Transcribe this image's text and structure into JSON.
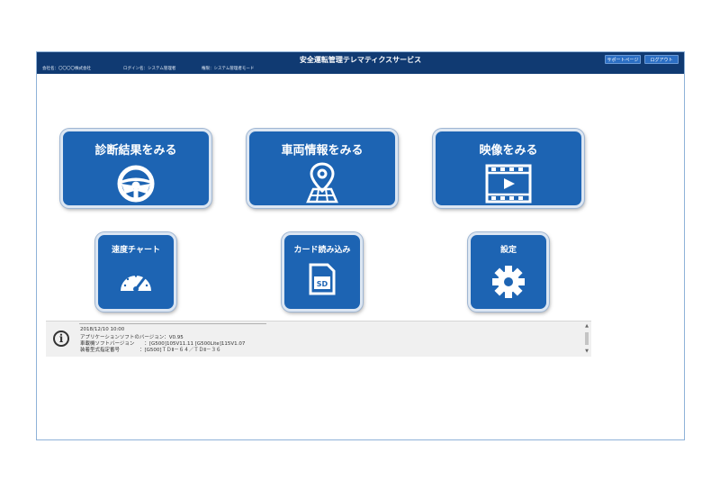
{
  "header": {
    "title": "安全運転管理テレマティクスサービス",
    "company": "会社名：〇〇〇〇株式会社",
    "login_name": "ログイン名：システム管理者",
    "permission": "権限：システム管理者モード",
    "support_button": "サポートページ",
    "logout_button": "ログアウト"
  },
  "tiles": {
    "diagnosis": {
      "label": "診断結果をみる",
      "icon": "steering-wheel-icon"
    },
    "vehicle": {
      "label": "車両情報をみる",
      "icon": "map-pin-icon"
    },
    "video": {
      "label": "映像をみる",
      "icon": "video-play-icon"
    },
    "speed_chart": {
      "label": "速度チャート",
      "icon": "speedometer-icon"
    },
    "card_read": {
      "label": "カード読み込み",
      "icon": "sd-card-icon"
    },
    "settings": {
      "label": "設定",
      "icon": "gear-icon"
    }
  },
  "info": {
    "icon": "info-icon",
    "lines": [
      "2018/12/10 10:00",
      "アプリケーションソフトのバージョン：V0.95",
      "車載機ソフトバージョン　　：[G500]105V11.11 [G500Lite]115V1.07",
      "装着型式指定番号　　　　：[G500]ＴＤⅡ－６４／ＴＤⅡ－３６"
    ]
  },
  "colors": {
    "header_bg": "#103a72",
    "tile_bg": "#1d64b3",
    "button_bg": "#2c6fc4"
  }
}
